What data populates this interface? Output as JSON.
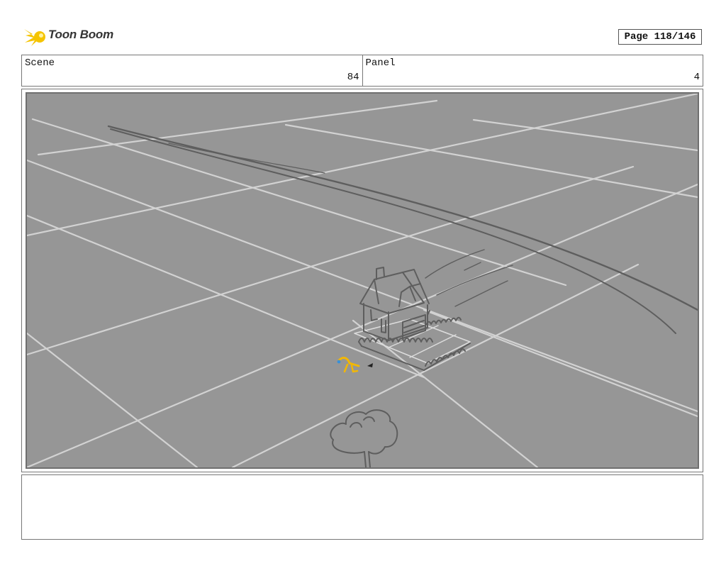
{
  "header": {
    "logo_text": "Toon Boom",
    "page_label": "Page 118/146"
  },
  "info": {
    "scene_label": "Scene",
    "scene_value": "84",
    "panel_label": "Panel",
    "panel_value": "4"
  },
  "notes": {
    "text": ""
  },
  "colors": {
    "panel_background": "#969696",
    "grid_lines": "#d2d2d2",
    "sketch_lines": "#5e5e5e",
    "character_yellow": "#f2b705",
    "character_blue": "#3a8fd8",
    "logo_yellow": "#f5c400"
  }
}
